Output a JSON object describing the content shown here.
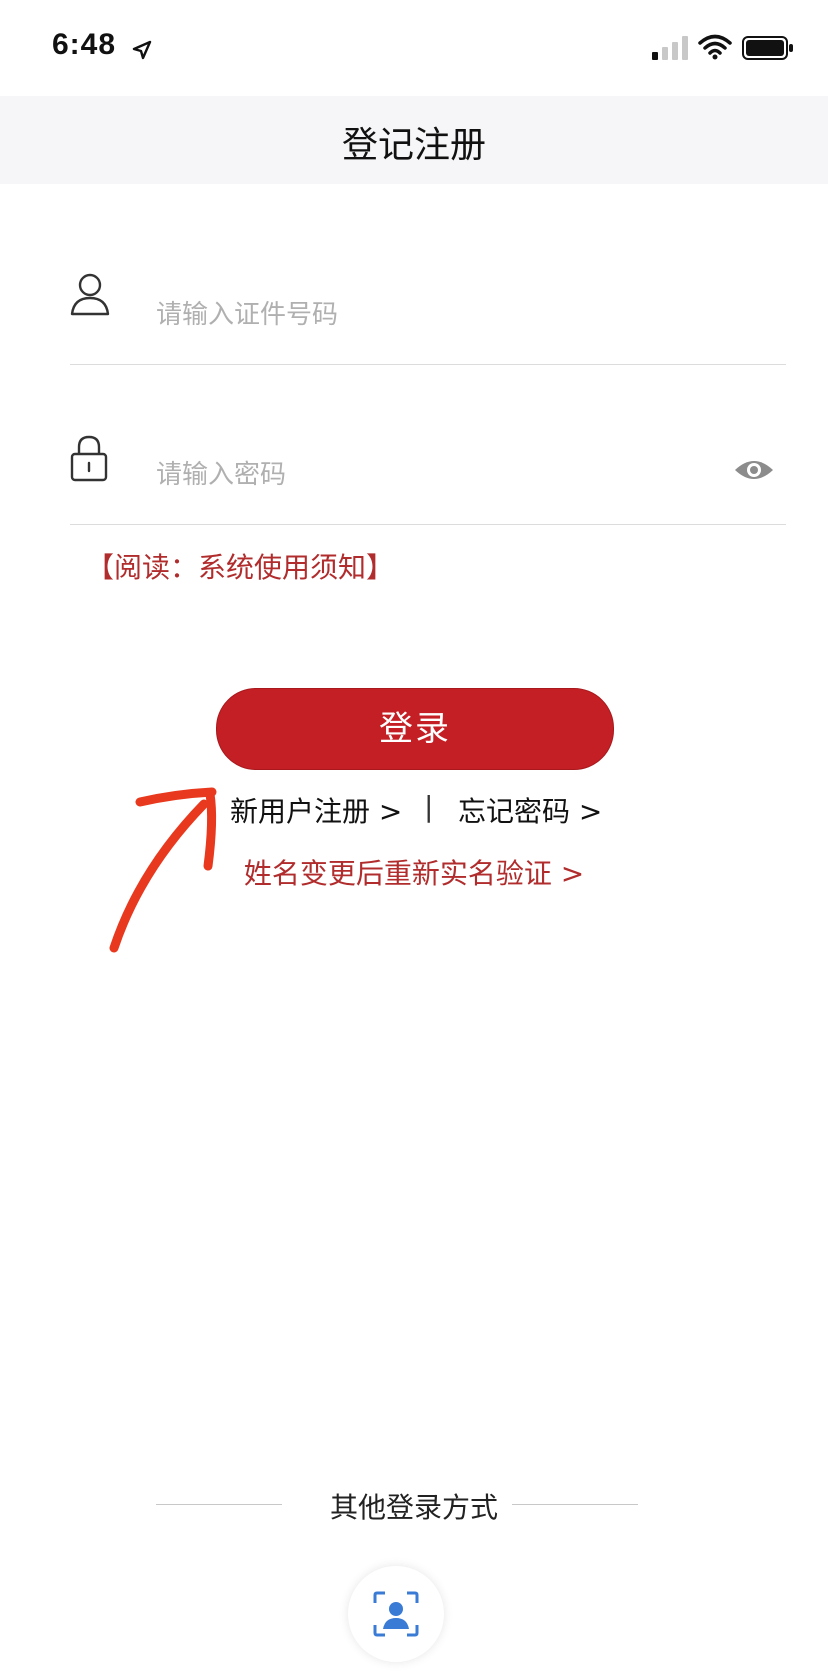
{
  "status_bar": {
    "time": "6:48"
  },
  "nav": {
    "title": "登记注册"
  },
  "form": {
    "id_placeholder": "请输入证件号码",
    "password_placeholder": "请输入密码",
    "notice": "【阅读：系统使用须知】",
    "login_label": "登录"
  },
  "links": {
    "register": "新用户注册 >",
    "separator": "|",
    "forgot": "忘记密码 >",
    "rename_verify": "姓名变更后重新实名验证 >"
  },
  "other_login": {
    "label": "其他登录方式"
  },
  "colors": {
    "accent": "#c41f24",
    "link_red": "#b12c2c",
    "annotation": "#e8391e"
  },
  "icons": [
    "location-arrow-icon",
    "signal-icon",
    "wifi-icon",
    "battery-icon",
    "user-icon",
    "lock-icon",
    "eye-icon",
    "face-id-icon"
  ]
}
